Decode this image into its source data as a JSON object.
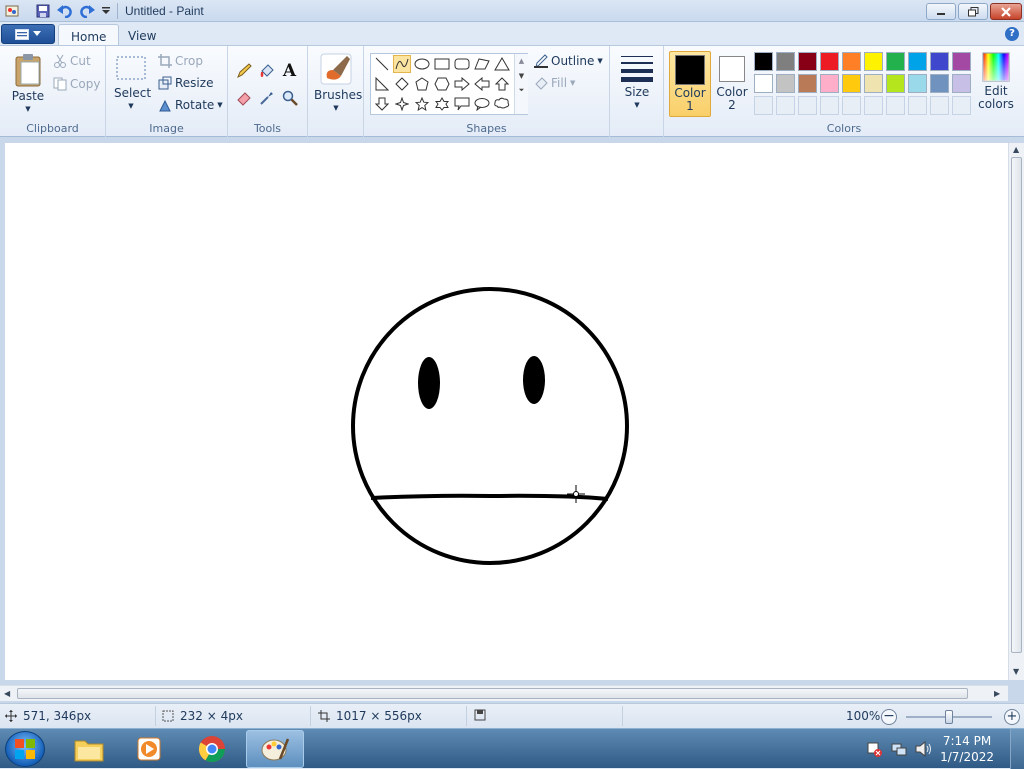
{
  "window": {
    "title": "Untitled - Paint"
  },
  "tabs": {
    "home": "Home",
    "view": "View"
  },
  "ribbon": {
    "clipboard": {
      "label": "Clipboard",
      "paste": "Paste",
      "cut": "Cut",
      "copy": "Copy"
    },
    "image": {
      "label": "Image",
      "select": "Select",
      "crop": "Crop",
      "resize": "Resize",
      "rotate": "Rotate"
    },
    "tools": {
      "label": "Tools"
    },
    "brushes": {
      "label": "Brushes"
    },
    "shapes": {
      "label": "Shapes",
      "outline": "Outline",
      "fill": "Fill"
    },
    "size": {
      "label": "Size"
    },
    "colors": {
      "label": "Colors",
      "color1_line1": "Color",
      "color1_line2": "1",
      "color2_line1": "Color",
      "color2_line2": "2",
      "edit_line1": "Edit",
      "edit_line2": "colors",
      "color1": "#000000",
      "color2": "#ffffff",
      "palette_row1": [
        "#000000",
        "#7f7f7f",
        "#880015",
        "#ed1c24",
        "#ff7f27",
        "#fff200",
        "#22b14c",
        "#00a2e8",
        "#3f48cc",
        "#a349a4"
      ],
      "palette_row2": [
        "#ffffff",
        "#c3c3c3",
        "#b97a57",
        "#ffaec9",
        "#ffc90e",
        "#efe4b0",
        "#b5e61d",
        "#99d9ea",
        "#7092be",
        "#c8bfe7"
      ]
    }
  },
  "status": {
    "cursor_pos": "571, 346px",
    "selection_size": "232 × 4px",
    "canvas_size": "1017 × 556px",
    "zoom": "100%"
  },
  "taskbar": {
    "time": "7:14 PM",
    "date": "1/7/2022"
  }
}
